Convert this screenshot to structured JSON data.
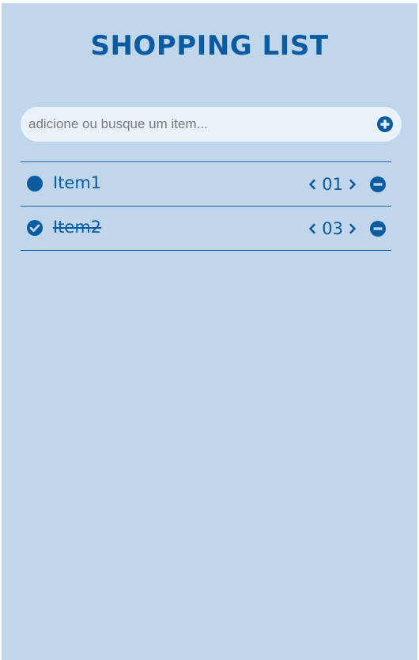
{
  "header": {
    "title": "SHOPPING LIST"
  },
  "search": {
    "placeholder": "adicione ou busque um item...",
    "value": ""
  },
  "items": [
    {
      "name": "Item1",
      "quantity": "01",
      "checked": false
    },
    {
      "name": "Item2",
      "quantity": "03",
      "checked": true
    }
  ],
  "colors": {
    "background": "#bfd6eb",
    "accent": "#0c5a9f",
    "input_bg": "#eaf2f9"
  }
}
